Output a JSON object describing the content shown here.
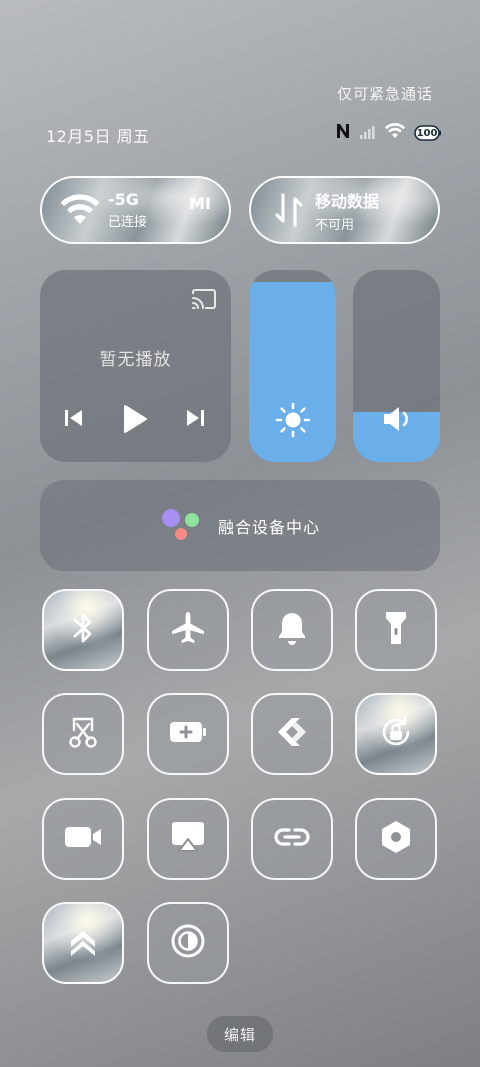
{
  "header": {
    "emergency_text": "仅可紧急通话",
    "date_text": "12月5日 周五",
    "battery_text": "100"
  },
  "connectivity": {
    "wifi": {
      "label": "-5G",
      "extra": "MI",
      "status": "已连接",
      "icon": "wifi-icon"
    },
    "mobile": {
      "label": "移动数据",
      "status": "不可用",
      "icon": "data-transfer-icon"
    }
  },
  "media": {
    "empty_text": "暂无播放"
  },
  "sliders": {
    "brightness": {
      "level": 0.94,
      "color": "#6aaeea"
    },
    "volume": {
      "level": 0.26,
      "color": "#6aaeea"
    }
  },
  "fusion": {
    "label": "融合设备中心"
  },
  "toggles": [
    {
      "name": "bluetooth",
      "active": true,
      "icon": "bluetooth-icon"
    },
    {
      "name": "airplane-mode",
      "active": false,
      "icon": "airplane-icon"
    },
    {
      "name": "ringer",
      "active": false,
      "icon": "bell-icon"
    },
    {
      "name": "flashlight",
      "active": false,
      "icon": "flashlight-icon"
    },
    {
      "name": "screenshot",
      "active": false,
      "icon": "scissors-icon"
    },
    {
      "name": "battery-saver",
      "active": false,
      "icon": "battery-plus-icon"
    },
    {
      "name": "link-share",
      "active": false,
      "icon": "share-arrows-icon"
    },
    {
      "name": "rotation-lock",
      "active": true,
      "icon": "rotation-lock-icon"
    },
    {
      "name": "screen-record",
      "active": false,
      "icon": "video-camera-icon"
    },
    {
      "name": "screen-cast",
      "active": false,
      "icon": "airplay-icon"
    },
    {
      "name": "interconnect",
      "active": false,
      "icon": "link-chain-icon"
    },
    {
      "name": "settings",
      "active": false,
      "icon": "hexagon-gear-icon"
    },
    {
      "name": "performance-mode",
      "active": true,
      "icon": "double-chevron-up-icon"
    },
    {
      "name": "contrast-mode",
      "active": false,
      "icon": "contrast-circle-icon"
    }
  ],
  "footer": {
    "edit_label": "编辑"
  }
}
